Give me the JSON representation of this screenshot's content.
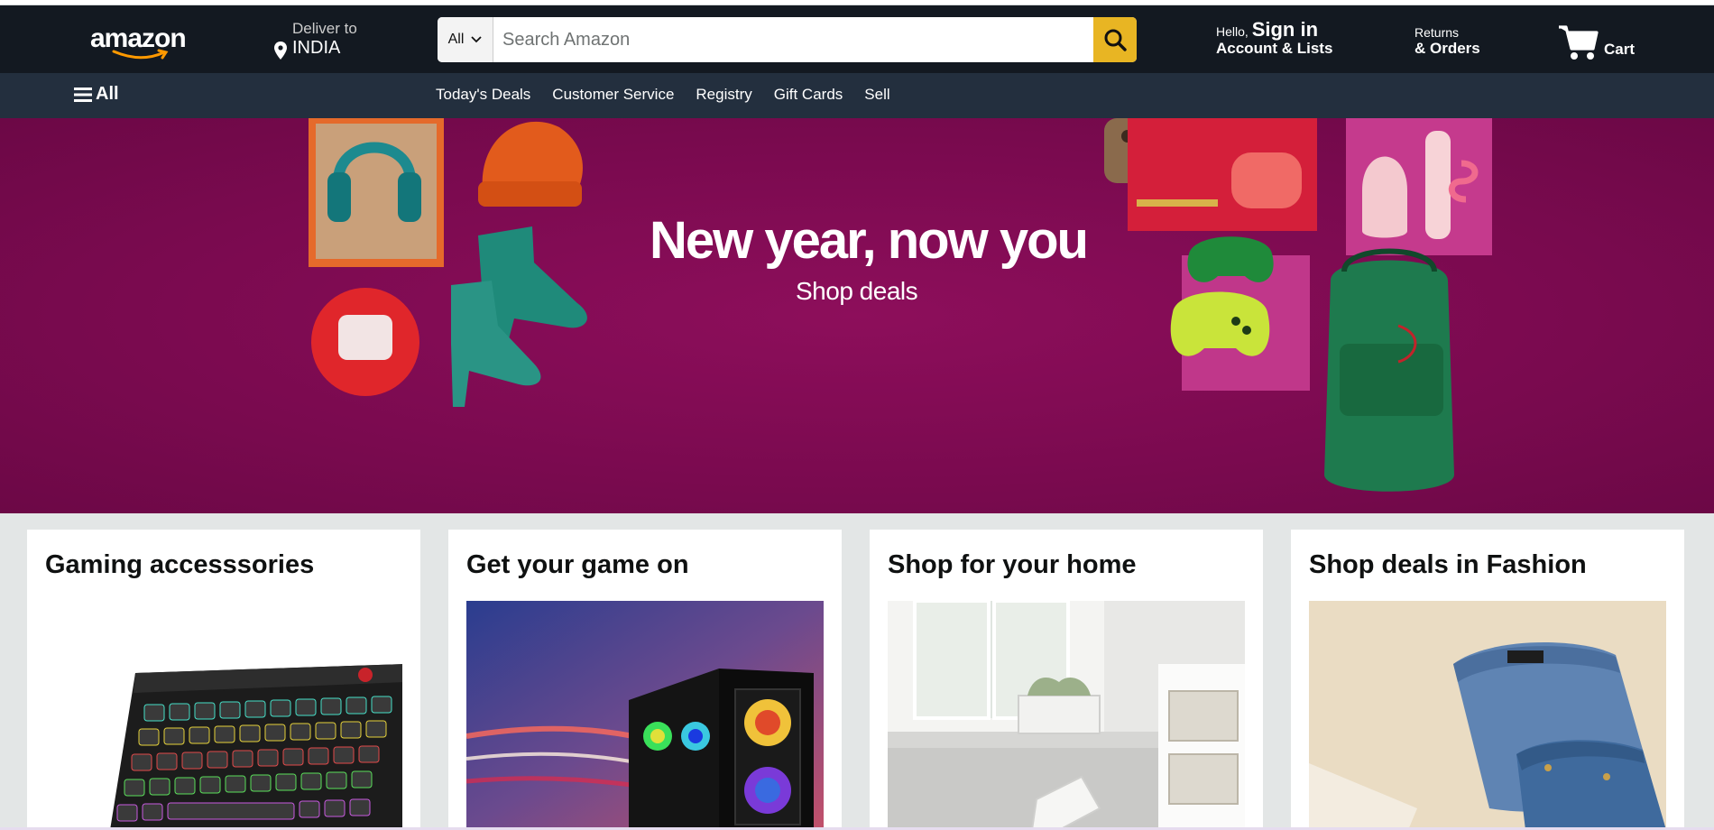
{
  "header": {
    "logo_text": "amazon",
    "deliver_label": "Deliver to",
    "deliver_location": "INDIA",
    "search": {
      "category": "All",
      "placeholder": "Search Amazon"
    },
    "account": {
      "greeting": "Hello,",
      "sign_in": "Sign in",
      "lists": "Account & Lists"
    },
    "returns": {
      "line1": "Returns",
      "line2": "& Orders"
    },
    "cart_label": "Cart"
  },
  "subnav": {
    "all_label": "All",
    "links": [
      "Today's Deals",
      "Customer Service",
      "Registry",
      "Gift Cards",
      "Sell"
    ]
  },
  "hero": {
    "title": "New year, now you",
    "subtitle": "Shop deals"
  },
  "cards": [
    {
      "title": "Gaming accesssories"
    },
    {
      "title": "Get your game on"
    },
    {
      "title": "Shop for your home"
    },
    {
      "title": "Shop deals in Fashion"
    }
  ],
  "colors": {
    "header_bg": "#131921",
    "subnav_bg": "#232f3e",
    "search_button": "#e8b523",
    "hero_bg": "#7a0a4f",
    "content_bg": "#e3e6e6"
  }
}
